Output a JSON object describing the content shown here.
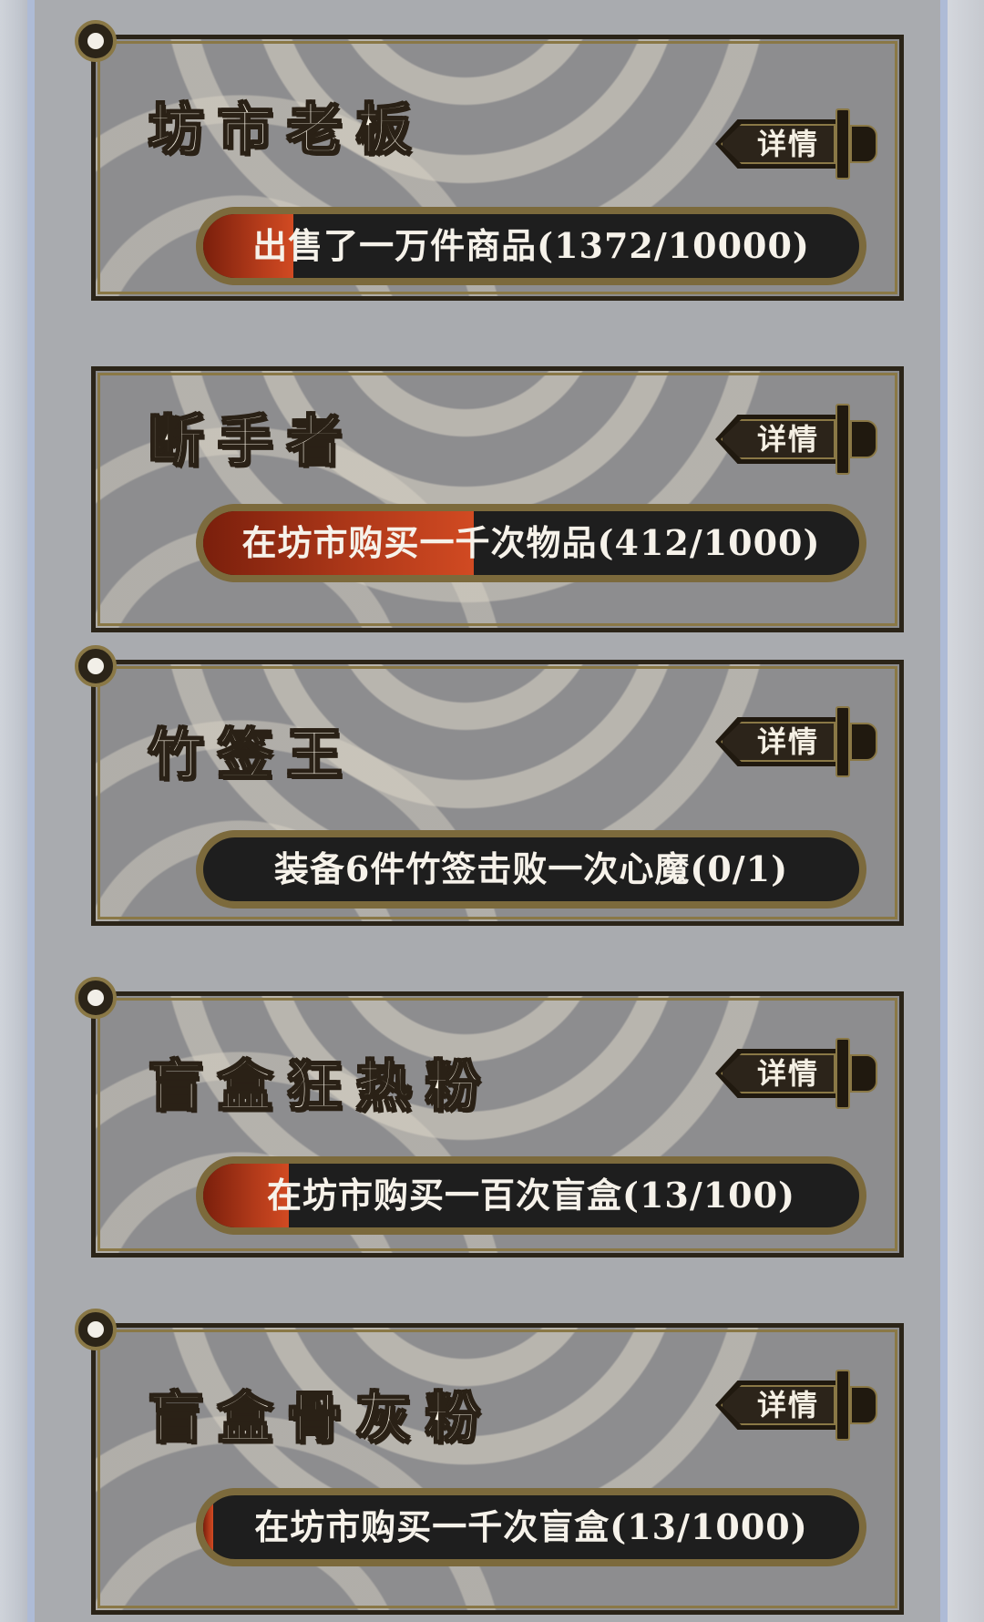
{
  "achievements": [
    {
      "title": "坊市老板",
      "detail_label": "详情",
      "description": "出售了一万件商品(1372/10000)",
      "progress_current": 1372,
      "progress_total": 10000,
      "has_pin": true
    },
    {
      "title": "断手者",
      "detail_label": "详情",
      "description": "在坊市购买一千次物品(412/1000)",
      "progress_current": 412,
      "progress_total": 1000,
      "has_pin": false
    },
    {
      "title": "竹签王",
      "detail_label": "详情",
      "description": "装备6件竹签击败一次心魔(0/1)",
      "progress_current": 0,
      "progress_total": 1,
      "has_pin": true
    },
    {
      "title": "盲盒狂热粉",
      "detail_label": "详情",
      "description": "在坊市购买一百次盲盒(13/100)",
      "progress_current": 13,
      "progress_total": 100,
      "has_pin": true
    },
    {
      "title": "盲盒骨灰粉",
      "detail_label": "详情",
      "description": "在坊市购买一千次盲盒(13/1000)",
      "progress_current": 13,
      "progress_total": 1000,
      "has_pin": true
    }
  ],
  "colors": {
    "progress_fill": "#b23a1a",
    "panel": "#8d8d8f",
    "frame_gold": "#8a7846",
    "track": "#1e1e1e"
  },
  "icons": {
    "detail_button": "sword-icon",
    "pin": "pin-icon"
  }
}
